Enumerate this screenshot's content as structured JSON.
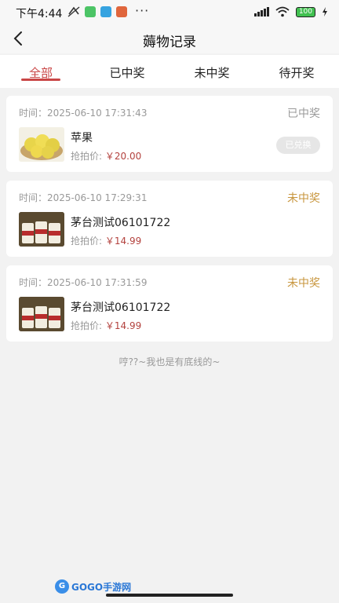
{
  "status_bar": {
    "time": "下午4:44",
    "battery": "100",
    "dots": "···"
  },
  "header": {
    "title": "薅物记录",
    "back_icon": "chevron-left-icon"
  },
  "tabs": [
    {
      "label": "全部",
      "active": true
    },
    {
      "label": "已中奖",
      "active": false
    },
    {
      "label": "未中奖",
      "active": false
    },
    {
      "label": "待开奖",
      "active": false
    }
  ],
  "records": [
    {
      "time": "时间：2025-06-10 17:31:43",
      "status": "已中奖",
      "name": "苹果",
      "price_label": "抢拍价:",
      "price": "￥20.00",
      "action": "已兑换",
      "image": "apple-image"
    },
    {
      "time": "时间：2025-06-10 17:29:31",
      "status": "未中奖",
      "name": "茅台测试06101722",
      "price_label": "抢拍价:",
      "price": "￥14.99",
      "image": "moutai-image"
    },
    {
      "time": "时间：2025-06-10 17:31:59",
      "status": "未中奖",
      "name": "茅台测试06101722",
      "price_label": "抢拍价:",
      "price": "￥14.99",
      "image": "moutai-image"
    }
  ],
  "footer": {
    "text": "哼??~我也是有底线的~"
  },
  "watermark": {
    "text": "GOGO手游网"
  },
  "colors": {
    "accent": "#c94646",
    "status_lost": "#c8963e",
    "status_won": "#9a9a9a",
    "price": "#b3423e"
  }
}
